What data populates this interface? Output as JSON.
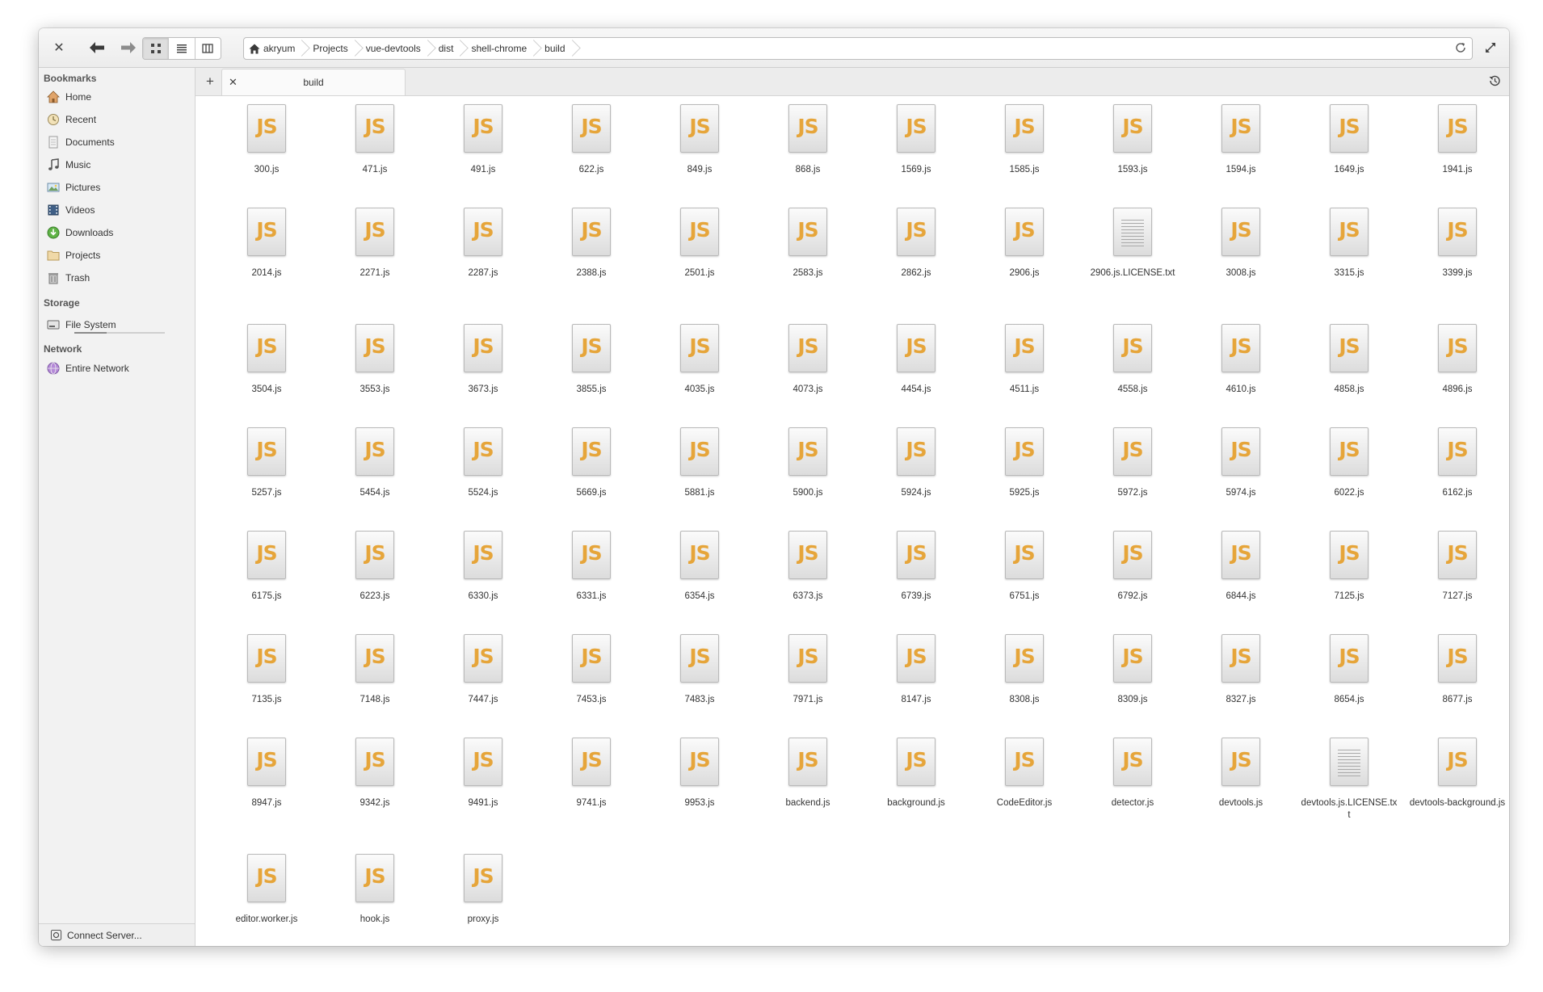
{
  "window": {
    "path": [
      "akryum",
      "Projects",
      "vue-devtools",
      "dist",
      "shell-chrome",
      "build"
    ]
  },
  "sidebar": {
    "bookmarks_header": "Bookmarks",
    "bookmarks": [
      {
        "label": "Home",
        "icon": "home-icon"
      },
      {
        "label": "Recent",
        "icon": "recent-icon"
      },
      {
        "label": "Documents",
        "icon": "documents-icon"
      },
      {
        "label": "Music",
        "icon": "music-icon"
      },
      {
        "label": "Pictures",
        "icon": "pictures-icon"
      },
      {
        "label": "Videos",
        "icon": "videos-icon"
      },
      {
        "label": "Downloads",
        "icon": "downloads-icon"
      },
      {
        "label": "Projects",
        "icon": "folder-icon"
      },
      {
        "label": "Trash",
        "icon": "trash-icon"
      }
    ],
    "storage_header": "Storage",
    "storage": [
      {
        "label": "File System",
        "icon": "drive-icon",
        "usage_fraction": 0.36
      }
    ],
    "network_header": "Network",
    "network": [
      {
        "label": "Entire Network",
        "icon": "network-icon"
      }
    ],
    "connect_server": "Connect Server..."
  },
  "tab": {
    "label": "build"
  },
  "files": [
    {
      "name": "300.js",
      "type": "js"
    },
    {
      "name": "471.js",
      "type": "js"
    },
    {
      "name": "491.js",
      "type": "js"
    },
    {
      "name": "622.js",
      "type": "js"
    },
    {
      "name": "849.js",
      "type": "js"
    },
    {
      "name": "868.js",
      "type": "js"
    },
    {
      "name": "1569.js",
      "type": "js"
    },
    {
      "name": "1585.js",
      "type": "js"
    },
    {
      "name": "1593.js",
      "type": "js"
    },
    {
      "name": "1594.js",
      "type": "js"
    },
    {
      "name": "1649.js",
      "type": "js"
    },
    {
      "name": "1941.js",
      "type": "js"
    },
    {
      "name": "2014.js",
      "type": "js"
    },
    {
      "name": "2271.js",
      "type": "js"
    },
    {
      "name": "2287.js",
      "type": "js"
    },
    {
      "name": "2388.js",
      "type": "js"
    },
    {
      "name": "2501.js",
      "type": "js"
    },
    {
      "name": "2583.js",
      "type": "js"
    },
    {
      "name": "2862.js",
      "type": "js"
    },
    {
      "name": "2906.js",
      "type": "js"
    },
    {
      "name": "2906.js.LICENSE.txt",
      "type": "txt"
    },
    {
      "name": "3008.js",
      "type": "js"
    },
    {
      "name": "3315.js",
      "type": "js"
    },
    {
      "name": "3399.js",
      "type": "js"
    },
    {
      "name": "3504.js",
      "type": "js"
    },
    {
      "name": "3553.js",
      "type": "js"
    },
    {
      "name": "3673.js",
      "type": "js"
    },
    {
      "name": "3855.js",
      "type": "js"
    },
    {
      "name": "4035.js",
      "type": "js"
    },
    {
      "name": "4073.js",
      "type": "js"
    },
    {
      "name": "4454.js",
      "type": "js"
    },
    {
      "name": "4511.js",
      "type": "js"
    },
    {
      "name": "4558.js",
      "type": "js"
    },
    {
      "name": "4610.js",
      "type": "js"
    },
    {
      "name": "4858.js",
      "type": "js"
    },
    {
      "name": "4896.js",
      "type": "js"
    },
    {
      "name": "5257.js",
      "type": "js"
    },
    {
      "name": "5454.js",
      "type": "js"
    },
    {
      "name": "5524.js",
      "type": "js"
    },
    {
      "name": "5669.js",
      "type": "js"
    },
    {
      "name": "5881.js",
      "type": "js"
    },
    {
      "name": "5900.js",
      "type": "js"
    },
    {
      "name": "5924.js",
      "type": "js"
    },
    {
      "name": "5925.js",
      "type": "js"
    },
    {
      "name": "5972.js",
      "type": "js"
    },
    {
      "name": "5974.js",
      "type": "js"
    },
    {
      "name": "6022.js",
      "type": "js"
    },
    {
      "name": "6162.js",
      "type": "js"
    },
    {
      "name": "6175.js",
      "type": "js"
    },
    {
      "name": "6223.js",
      "type": "js"
    },
    {
      "name": "6330.js",
      "type": "js"
    },
    {
      "name": "6331.js",
      "type": "js"
    },
    {
      "name": "6354.js",
      "type": "js"
    },
    {
      "name": "6373.js",
      "type": "js"
    },
    {
      "name": "6739.js",
      "type": "js"
    },
    {
      "name": "6751.js",
      "type": "js"
    },
    {
      "name": "6792.js",
      "type": "js"
    },
    {
      "name": "6844.js",
      "type": "js"
    },
    {
      "name": "7125.js",
      "type": "js"
    },
    {
      "name": "7127.js",
      "type": "js"
    },
    {
      "name": "7135.js",
      "type": "js"
    },
    {
      "name": "7148.js",
      "type": "js"
    },
    {
      "name": "7447.js",
      "type": "js"
    },
    {
      "name": "7453.js",
      "type": "js"
    },
    {
      "name": "7483.js",
      "type": "js"
    },
    {
      "name": "7971.js",
      "type": "js"
    },
    {
      "name": "8147.js",
      "type": "js"
    },
    {
      "name": "8308.js",
      "type": "js"
    },
    {
      "name": "8309.js",
      "type": "js"
    },
    {
      "name": "8327.js",
      "type": "js"
    },
    {
      "name": "8654.js",
      "type": "js"
    },
    {
      "name": "8677.js",
      "type": "js"
    },
    {
      "name": "8947.js",
      "type": "js"
    },
    {
      "name": "9342.js",
      "type": "js"
    },
    {
      "name": "9491.js",
      "type": "js"
    },
    {
      "name": "9741.js",
      "type": "js"
    },
    {
      "name": "9953.js",
      "type": "js"
    },
    {
      "name": "backend.js",
      "type": "js"
    },
    {
      "name": "background.js",
      "type": "js"
    },
    {
      "name": "CodeEditor.js",
      "type": "js"
    },
    {
      "name": "detector.js",
      "type": "js"
    },
    {
      "name": "devtools.js",
      "type": "js"
    },
    {
      "name": "devtools.js.LICENSE.txt",
      "type": "txt"
    },
    {
      "name": "devtools-background.js",
      "type": "js"
    },
    {
      "name": "editor.worker.js",
      "type": "js"
    },
    {
      "name": "hook.js",
      "type": "js"
    },
    {
      "name": "proxy.js",
      "type": "js"
    }
  ],
  "colors": {
    "js_label": "#e6a53a",
    "sidebar_bg": "#f2f2f2",
    "view_bg": "#ffffff"
  }
}
